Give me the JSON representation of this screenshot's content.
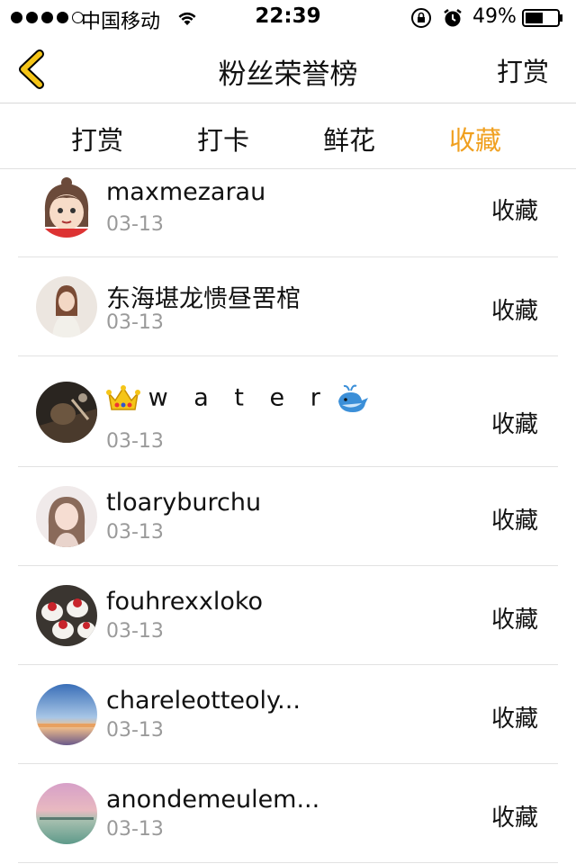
{
  "status_bar": {
    "carrier": "中国移动",
    "time": "22:39",
    "battery_percent": "49%",
    "signal_bars": 4
  },
  "nav": {
    "title": "粉丝荣誉榜",
    "action_label": "打赏",
    "back_icon": "chevron-left-icon",
    "accent_color": "#f5c518"
  },
  "tabs": [
    {
      "label": "打赏",
      "active": false
    },
    {
      "label": "打卡",
      "active": false
    },
    {
      "label": "鲜花",
      "active": false
    },
    {
      "label": "收藏",
      "active": true
    }
  ],
  "active_tab_color": "#f0a020",
  "list": [
    {
      "name": "maxmezarau",
      "date": "03-13",
      "action": "收藏",
      "avatar": "cartoon-girl-avatar"
    },
    {
      "name": "东海堪龙愦昼罟棺",
      "date": "03-13",
      "action": "收藏",
      "avatar": "girl-photo-avatar"
    },
    {
      "name": "w a t e r",
      "date": "03-13",
      "action": "收藏",
      "avatar": "dark-photo-avatar",
      "prefix_icon": "crown-icon",
      "suffix_icon": "whale-icon"
    },
    {
      "name": "tloaryburchu",
      "date": "03-13",
      "action": "收藏",
      "avatar": "girl-portrait-avatar"
    },
    {
      "name": "fouhrexxloko",
      "date": "03-13",
      "action": "收藏",
      "avatar": "cupcakes-avatar"
    },
    {
      "name": "chareleotteoly...",
      "date": "03-13",
      "action": "收藏",
      "avatar": "sunset-avatar"
    },
    {
      "name": "anondemeulem...",
      "date": "03-13",
      "action": "收藏",
      "avatar": "pink-sky-avatar"
    }
  ]
}
